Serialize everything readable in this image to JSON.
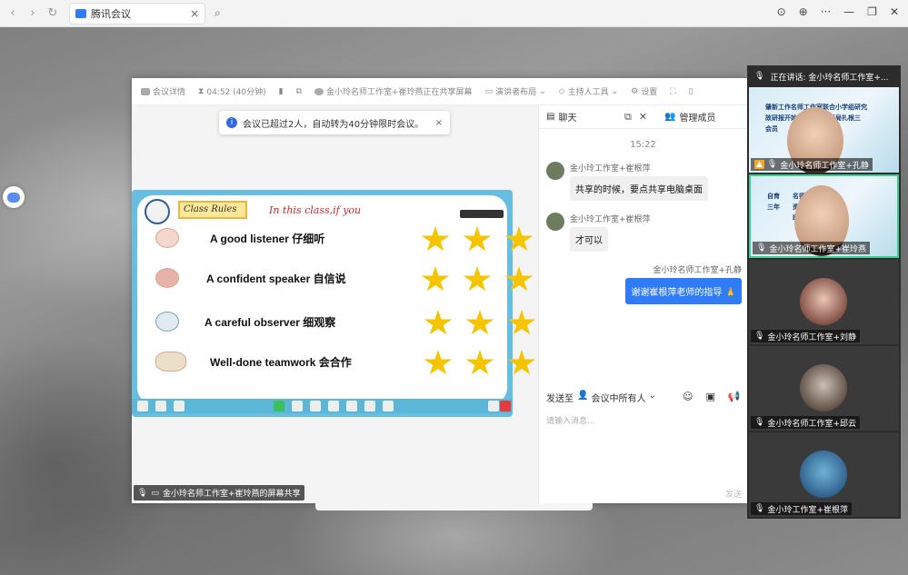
{
  "browser": {
    "tab_title": "腾讯会议"
  },
  "meeting_toolbar": {
    "details": "会议详情",
    "timer": "04:52 (40分钟)",
    "sharing": "金小玲名师工作室+崔玲燕正在共享屏幕",
    "layout": "演讲者布局",
    "host_tools": "主持人工具",
    "settings": "设置"
  },
  "notice": {
    "text": "会议已超过2人，自动转为40分钟限时会议。"
  },
  "slide": {
    "title_tag": "Class Rules",
    "subtitle": "In this class,if you",
    "rules": [
      {
        "text": "A good listener  仔细听",
        "icon": "ear-icon"
      },
      {
        "text": "A confident speaker 自信说",
        "icon": "mouth-icon"
      },
      {
        "text": "A careful observer 细观察",
        "icon": "eye-icon"
      },
      {
        "text": "Well-done teamwork  会合作",
        "icon": "handshake-icon"
      }
    ]
  },
  "share_label": "金小玲名师工作室+崔玲燕的屏幕共享",
  "chat": {
    "tab_chat": "聊天",
    "tab_members": "管理成员",
    "time": "15:22",
    "messages": [
      {
        "sender": "金小玲工作室+崔根萍",
        "text": "共享的时候，要点共享电脑桌面"
      },
      {
        "sender": "金小玲工作室+崔根萍",
        "text": "才可以"
      }
    ],
    "my_message": {
      "sender": "金小玲名师工作室+孔静",
      "text": "谢谢崔根萍老师的指导 🙏"
    },
    "send_to_label": "发送至",
    "send_to_target": "会议中所有人",
    "input_placeholder": "请输入消息...",
    "send_button": "发送"
  },
  "videos": {
    "speaking": "正在讲话:  金小玲名师工作室+...",
    "tiles": [
      {
        "name": "金小玲名师工作室+孔静",
        "ppt": "肇新工作名师工作室联合小学组研究\n故研报开始学以学思开新局扎根三\n会员"
      },
      {
        "name": "金小玲名师工作室+崔玲燕",
        "ppt": "自育   名师工作室\n三年   资源开发团队\n      联合"
      },
      {
        "name": "金小玲名师工作室+刘静"
      },
      {
        "name": "金小玲名师工作室+邱云"
      },
      {
        "name": "金小玲工作室+崔根萍"
      }
    ]
  }
}
